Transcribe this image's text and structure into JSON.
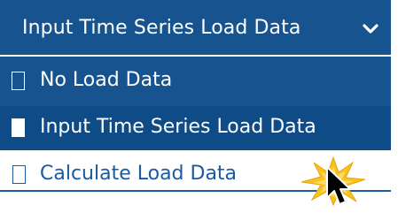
{
  "dropdown": {
    "selected_label": "Input Time Series Load Data",
    "chevron_icon": "chevron-down-icon"
  },
  "menu": {
    "items": [
      {
        "label": "No Load Data",
        "checked": false
      },
      {
        "label": "Input Time Series Load Data",
        "checked": true
      },
      {
        "label": "Calculate Load Data",
        "checked": false
      }
    ]
  },
  "colors": {
    "accent": "#17548f",
    "selected_row": "#0f4b86",
    "link_blue": "#1b5aa0",
    "burst_yellow": "#f7c21b"
  },
  "icons": {
    "cursor": "mouse-pointer-icon",
    "burst": "click-burst-icon"
  }
}
